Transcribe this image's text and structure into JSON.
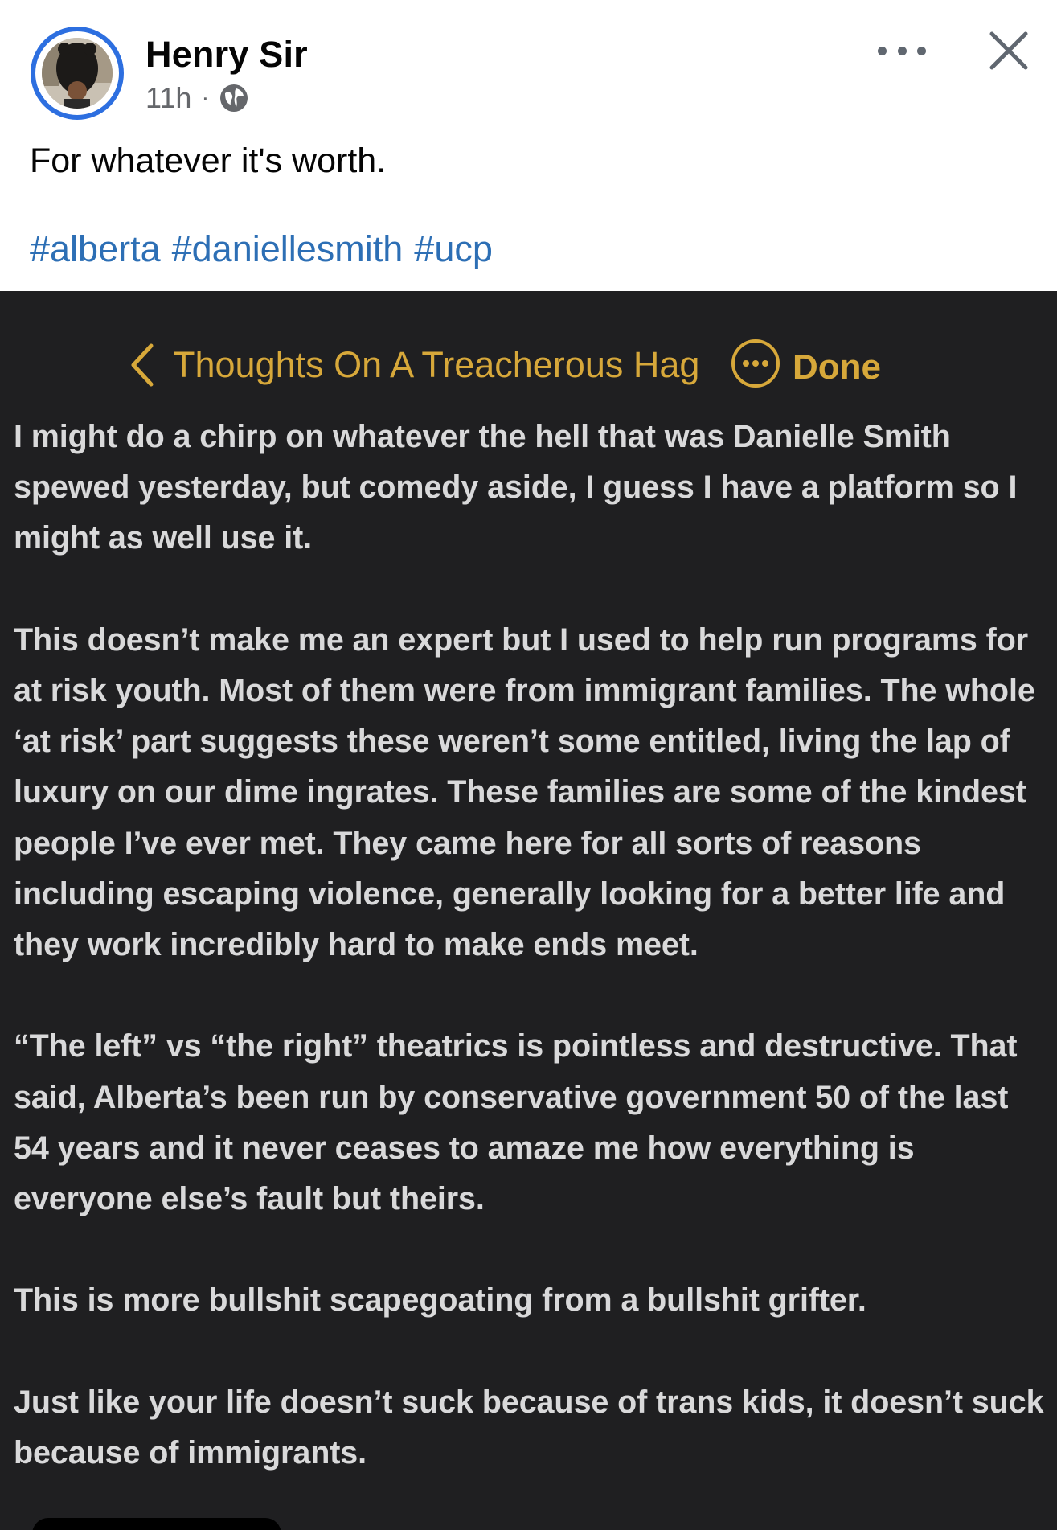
{
  "post": {
    "author": "Henry Sir",
    "time": "11h",
    "separator": "·",
    "privacy_icon": "globe-icon",
    "caption": "For whatever it's worth.",
    "hashtags": [
      "#alberta",
      "#daniellesmith",
      "#ucp"
    ],
    "more_icon": "more-options-icon",
    "close_icon": "close-icon"
  },
  "note": {
    "back_icon": "chevron-left-icon",
    "title": "Thoughts On A Treacherous Hag",
    "more_icon": "ellipsis-circle-icon",
    "done_label": "Done",
    "accent_color": "#d7a83a",
    "paragraphs": [
      "I might do a chirp on whatever the hell that was Danielle Smith spewed yesterday, but comedy aside, I guess I have a platform so I might as well use it.",
      "This doesn’t make me an expert but I used to help run programs for at risk youth. Most of them were from immigrant families. The whole ‘at risk’ part suggests these weren’t some entitled, living the lap of luxury on our dime ingrates. These families are some of the kindest people I’ve ever met. They came here for all sorts of reasons including escaping violence, generally looking for a better life and they work incredibly hard to make ends meet.",
      "“The left” vs “the right” theatrics is pointless and destructive. That said, Alberta’s been run by conservative government 50 of the last 54 years and it never ceases to amaze me how everything is everyone else’s fault but theirs.",
      "This is more bullshit scapegoating from a bullshit grifter.",
      "Just like your life doesn’t suck because of trans kids, it doesn’t suck because of immigrants."
    ]
  },
  "colors": {
    "avatar_ring": "#2d6fe0",
    "hashtag": "#2d6fb5",
    "note_background": "#1f1f21",
    "note_text": "#d9d9da"
  }
}
